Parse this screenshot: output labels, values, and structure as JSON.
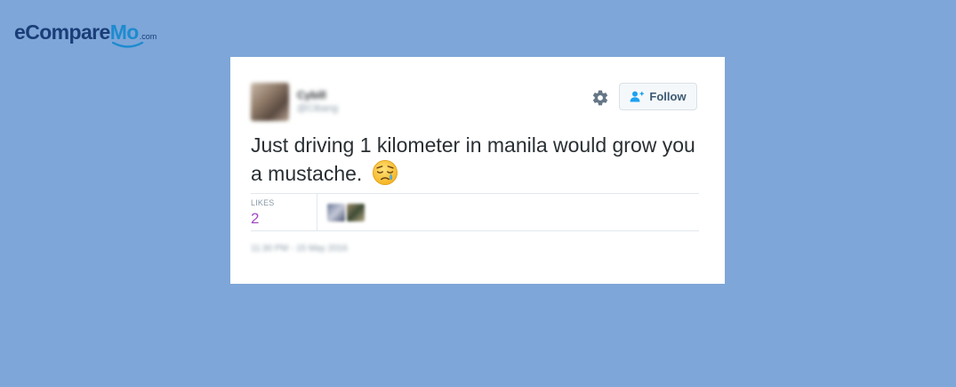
{
  "brand": {
    "name_part1": "eCompare",
    "name_part2": "Mo",
    "domain": ".com",
    "colors": {
      "primary": "#1a3d78",
      "accent": "#1e8bd0"
    }
  },
  "background_color": "#7ea6d8",
  "tweet": {
    "author": {
      "display_name": "Cybill",
      "handle": "@Cibang",
      "avatar_icon": "avatar-photo-blurred"
    },
    "actions": {
      "settings_icon": "gear-icon",
      "follow_icon": "add-user-icon",
      "follow_label": "Follow"
    },
    "text": "Just driving 1 kilometer in manila would grow you a mustache.",
    "emoji_icon": "sleepy-face-emoji",
    "stats": {
      "likes_label": "LIKES",
      "likes_count": "2",
      "likes_color": "#a349c4"
    },
    "timestamp": "11:30 PM - 15 May 2016"
  }
}
